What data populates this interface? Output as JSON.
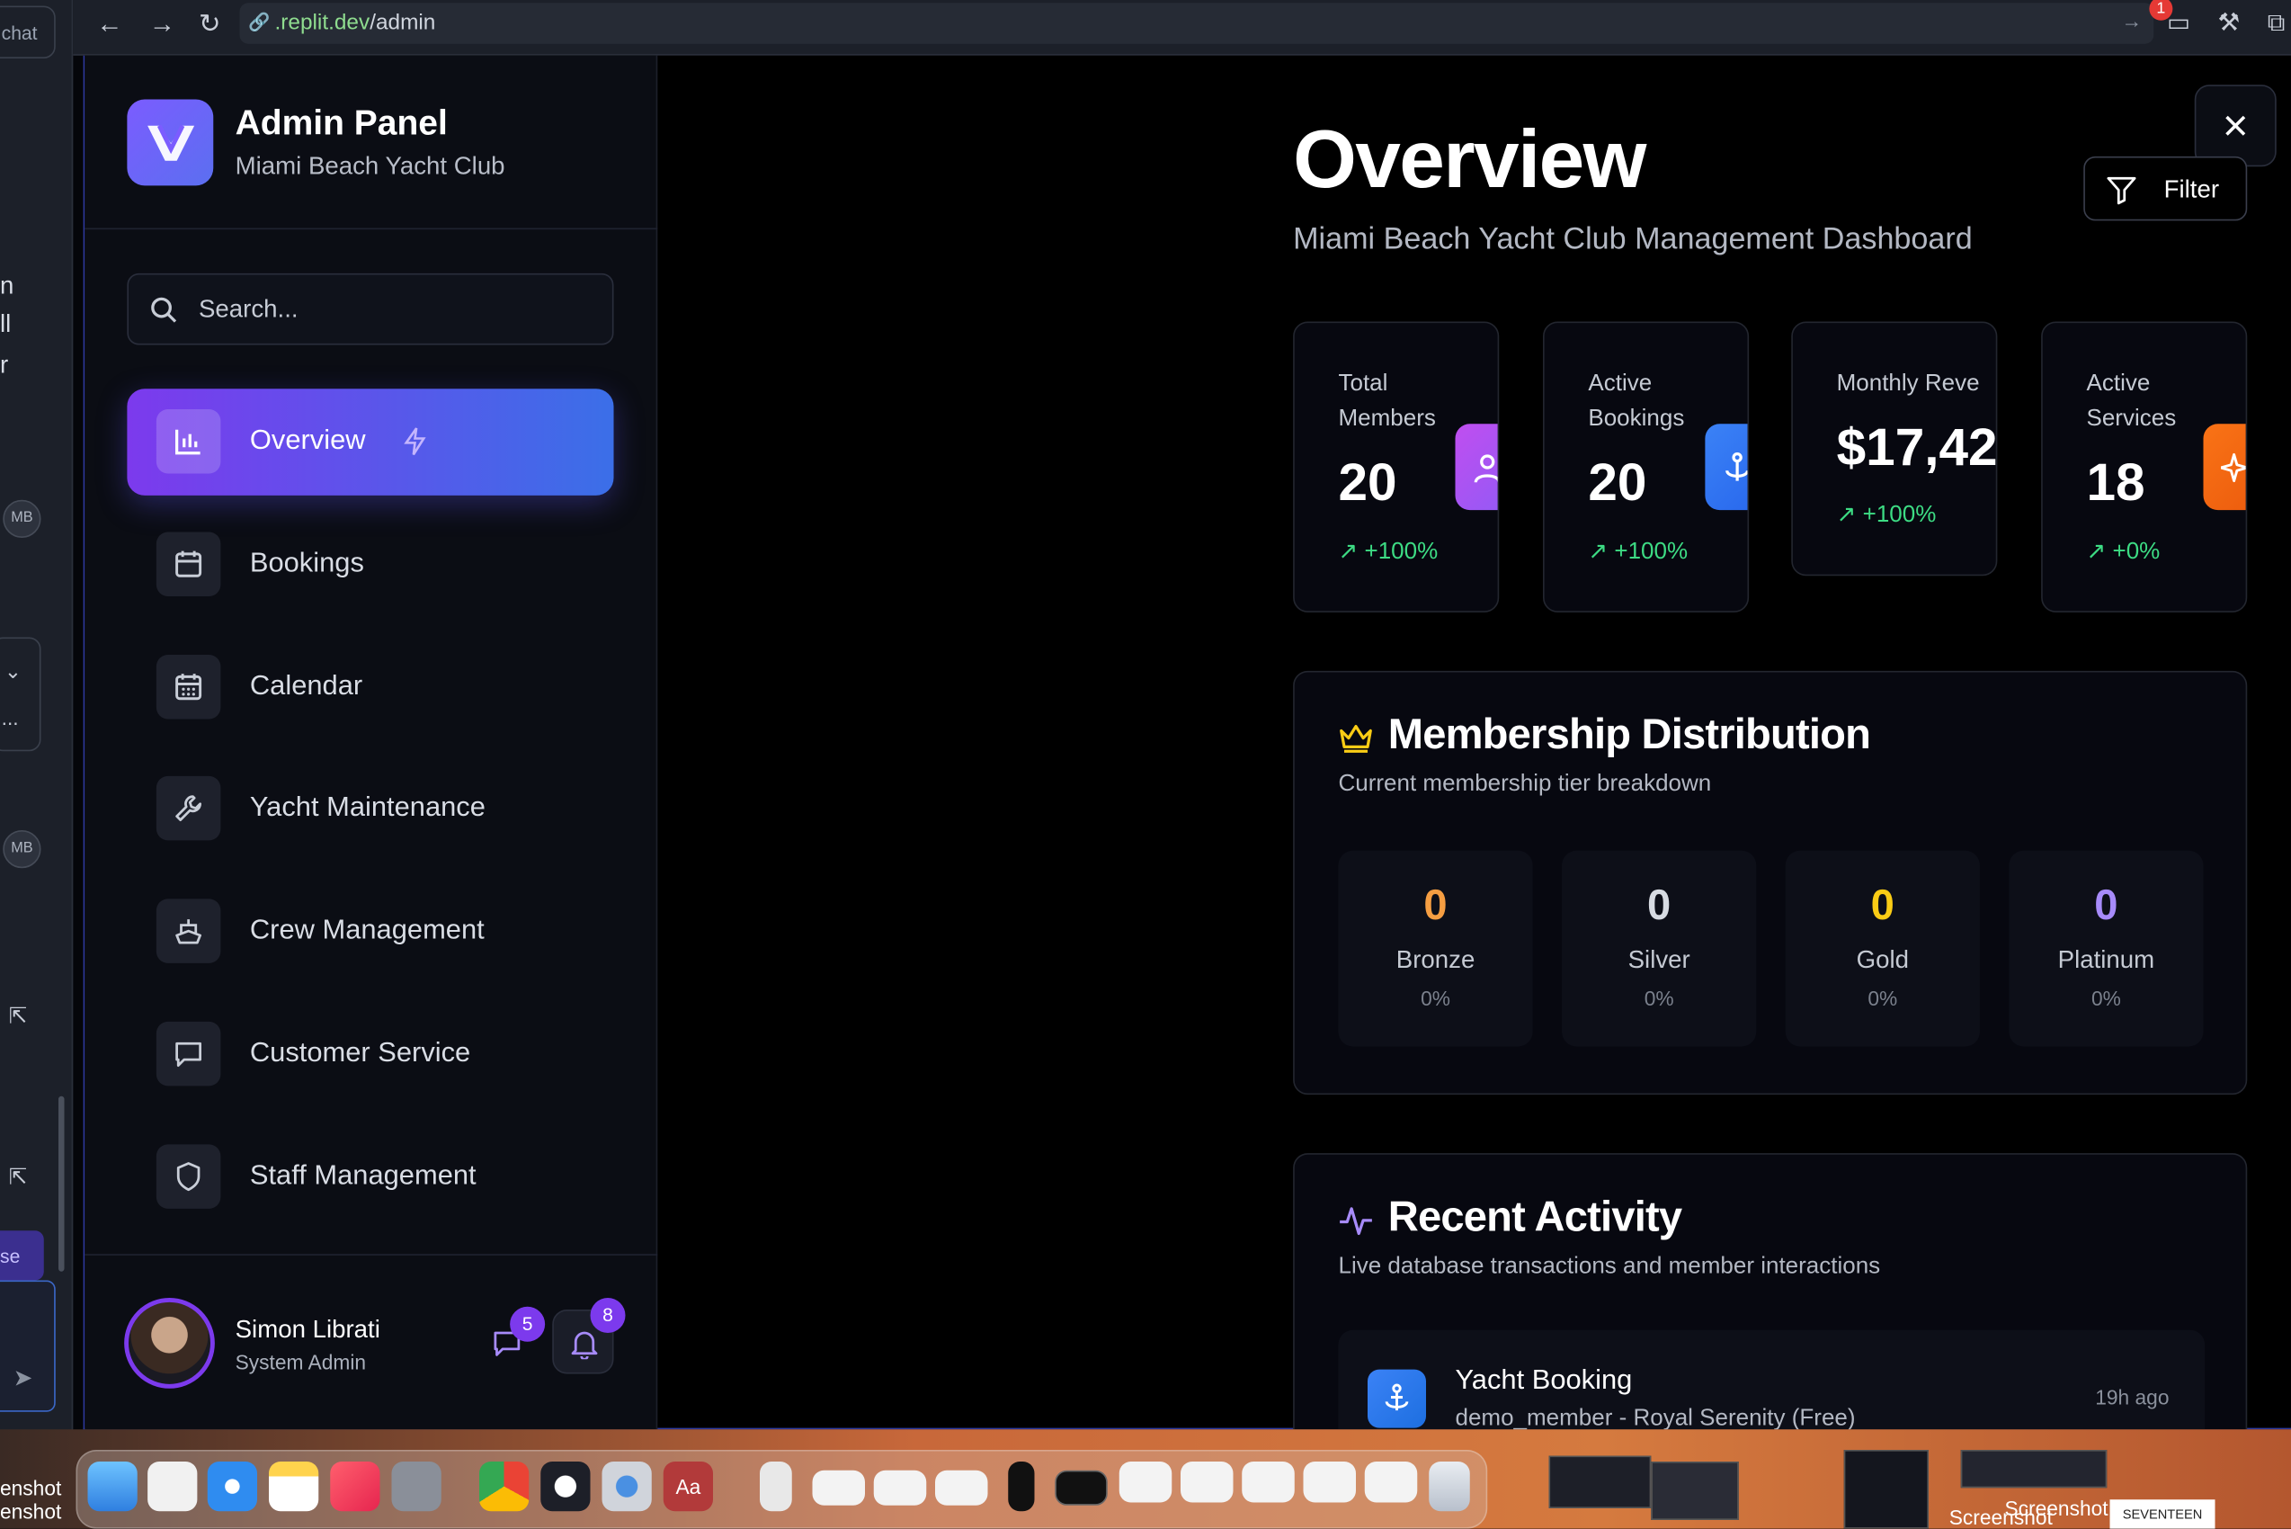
{
  "browser": {
    "url_domain": ".replit.dev",
    "url_path": "/admin",
    "notification_count": "1"
  },
  "replit_strip": {
    "chat_label": "chat",
    "text_frags": [
      "n",
      "ll",
      "r",
      "..."
    ],
    "mb_label": "MB",
    "use_label": "se"
  },
  "sidebar": {
    "title": "Admin Panel",
    "subtitle": "Miami Beach Yacht Club",
    "search_placeholder": "Search...",
    "items": [
      {
        "label": "Overview",
        "icon": "bar-chart-icon",
        "active": true
      },
      {
        "label": "Bookings",
        "icon": "calendar-icon"
      },
      {
        "label": "Calendar",
        "icon": "calendar-grid-icon"
      },
      {
        "label": "Yacht Maintenance",
        "icon": "wrench-icon"
      },
      {
        "label": "Crew Management",
        "icon": "ship-icon"
      },
      {
        "label": "Customer Service",
        "icon": "message-icon"
      },
      {
        "label": "Staff Management",
        "icon": "shield-icon"
      }
    ],
    "user": {
      "name": "Simon Librati",
      "role": "System Admin",
      "messages": "5",
      "notifications": "8"
    }
  },
  "main": {
    "title": "Overview",
    "subtitle": "Miami Beach Yacht Club Management Dashboard",
    "filter_label": "Filter",
    "stats": [
      {
        "title": "Total Members",
        "value": "20",
        "delta": "+100%",
        "color": "#a855f7"
      },
      {
        "title": "Active Bookings",
        "value": "20",
        "delta": "+100%",
        "color": "#3b82f6"
      },
      {
        "title": "Monthly Reve",
        "value": "$17,42",
        "delta": "+100%",
        "color": "#22c55e"
      },
      {
        "title": "Active Services",
        "value": "18",
        "delta": "+0%",
        "color": "#f97316"
      }
    ],
    "membership": {
      "title": "Membership Distribution",
      "subtitle": "Current membership tier breakdown",
      "tiers": [
        {
          "count": "0",
          "name": "Bronze",
          "pct": "0%",
          "color": "#f59e42"
        },
        {
          "count": "0",
          "name": "Silver",
          "pct": "0%",
          "color": "#d7dbe2"
        },
        {
          "count": "0",
          "name": "Gold",
          "pct": "0%",
          "color": "#facc15"
        },
        {
          "count": "0",
          "name": "Platinum",
          "pct": "0%",
          "color": "#a78bfa"
        }
      ]
    },
    "activity": {
      "title": "Recent Activity",
      "subtitle": "Live database transactions and member interactions",
      "items": [
        {
          "title": "Yacht Booking",
          "desc": "demo_member - Royal Serenity (Free)",
          "time": "19h ago"
        }
      ]
    }
  },
  "dock": {
    "screenshot_label": "Screenshot",
    "frag_left_1": "enshot",
    "frag_left_2": "enshot",
    "seventeen": "SEVENTEEN"
  }
}
